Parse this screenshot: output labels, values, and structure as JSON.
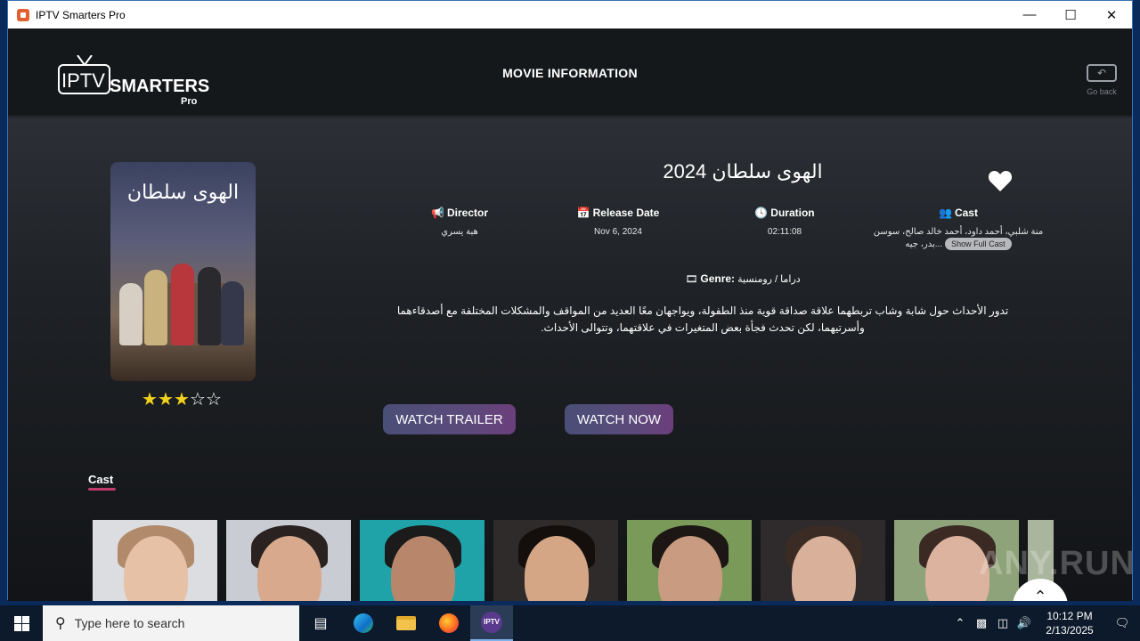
{
  "window": {
    "title": "IPTV Smarters Pro"
  },
  "header": {
    "logo_main": "IPTV",
    "logo_brand": "SMARTERS",
    "logo_sub": "Pro",
    "page_title": "MOVIE INFORMATION",
    "go_back_label": "Go back"
  },
  "movie": {
    "title": "الهوى سلطان 2024",
    "poster_title": "الهوى سلطان",
    "rating": 3,
    "rating_max": 5,
    "director_label": "Director",
    "director": "هبة يسري",
    "release_label": "Release Date",
    "release": "Nov 6, 2024",
    "duration_label": "Duration",
    "duration": "02:11:08",
    "cast_label": "Cast",
    "cast_short": "منة شلبي، أحمد داود، أحمد خالد صالح، سوسن بدر، جيه...",
    "show_full_cast": "Show Full Cast",
    "genre_label": "Genre:",
    "genre": "دراما / رومنسية",
    "description": "تدور الأحداث حول شابة وشاب تربطهما علاقة صداقة قوية منذ الطفولة، ويواجهان معًا العديد من المواقف والمشكلات المختلفة مع أصدقاءهما وأسرتيهما، لكن تحدث فجأة بعض المتغيرات في علاقتهما، وتتوالى الأحداث."
  },
  "buttons": {
    "watch_trailer": "WATCH TRAILER",
    "watch_now": "WATCH NOW"
  },
  "cast_section": {
    "heading": "Cast"
  },
  "watermark": "ANY.RUN",
  "taskbar": {
    "search_placeholder": "Type here to search",
    "time": "10:12 PM",
    "date": "2/13/2025"
  },
  "colors": {
    "accent_star": "#f1d11b",
    "button_gradient_start": "#4a4f78",
    "button_gradient_end": "#6b3f7c",
    "underline": "#c23a6b"
  }
}
